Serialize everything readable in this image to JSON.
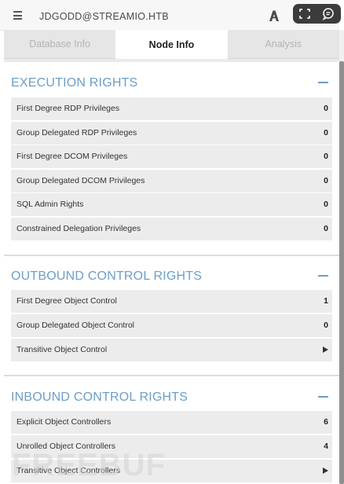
{
  "header": {
    "node_name": "JDGODD@STREAMIO.HTB",
    "menu_icon": "hamburger-menu-icon",
    "logo_icon": "bloodhound-logo-icon"
  },
  "overlay": {
    "expand_icon": "expand-icon",
    "chat_icon": "chat-icon"
  },
  "tabs": [
    {
      "label": "Database Info",
      "active": false
    },
    {
      "label": "Node Info",
      "active": true
    },
    {
      "label": "Analysis",
      "active": false
    }
  ],
  "sections": {
    "execution": {
      "title": "EXECUTION RIGHTS",
      "rows": [
        {
          "label": "First Degree RDP Privileges",
          "value": "0"
        },
        {
          "label": "Group Delegated RDP Privileges",
          "value": "0"
        },
        {
          "label": "First Degree DCOM Privileges",
          "value": "0"
        },
        {
          "label": "Group Delegated DCOM Privileges",
          "value": "0"
        },
        {
          "label": "SQL Admin Rights",
          "value": "0"
        },
        {
          "label": "Constrained Delegation Privileges",
          "value": "0"
        }
      ]
    },
    "outbound": {
      "title": "OUTBOUND CONTROL RIGHTS",
      "rows": [
        {
          "label": "First Degree Object Control",
          "value": "1"
        },
        {
          "label": "Group Delegated Object Control",
          "value": "0"
        },
        {
          "label": "Transitive Object Control",
          "value": ""
        }
      ]
    },
    "inbound": {
      "title": "INBOUND CONTROL RIGHTS",
      "rows": [
        {
          "label": "Explicit Object Controllers",
          "value": "6"
        },
        {
          "label": "Unrolled Object Controllers",
          "value": "4"
        },
        {
          "label": "Transitive Object Controllers",
          "value": ""
        }
      ]
    }
  },
  "watermark": {
    "text": "FREEBUF"
  },
  "colors": {
    "section_title": "#6c9ec8",
    "row_bg": "#ececec",
    "tab_inactive_bg": "#e6e6e6"
  }
}
